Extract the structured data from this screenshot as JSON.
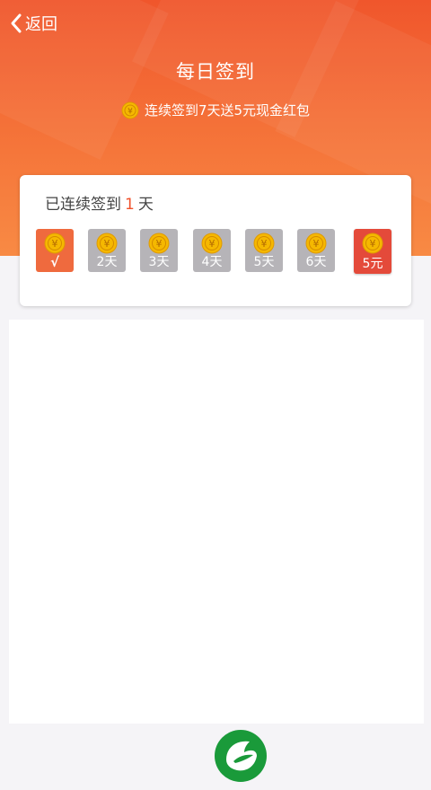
{
  "nav": {
    "back_label": "返回"
  },
  "header": {
    "title": "每日签到",
    "subtitle": "连续签到7天送5元现金红包"
  },
  "streak": {
    "prefix": "已连续签到",
    "count": "1",
    "suffix": "天"
  },
  "days": [
    {
      "label": "√",
      "state": "checked"
    },
    {
      "label": "2天",
      "state": "pending"
    },
    {
      "label": "3天",
      "state": "pending"
    },
    {
      "label": "4天",
      "state": "pending"
    },
    {
      "label": "5天",
      "state": "pending"
    },
    {
      "label": "6天",
      "state": "pending"
    },
    {
      "label": "5元",
      "state": "reward"
    }
  ],
  "colors": {
    "header_top": "#f0562c",
    "header_bottom": "#f88a44",
    "accent": "#f0502a",
    "pending_day": "#b6b4b8",
    "reward": "#e44a3a",
    "coin": "#f5b800",
    "logo_green": "#1a9a3a"
  }
}
